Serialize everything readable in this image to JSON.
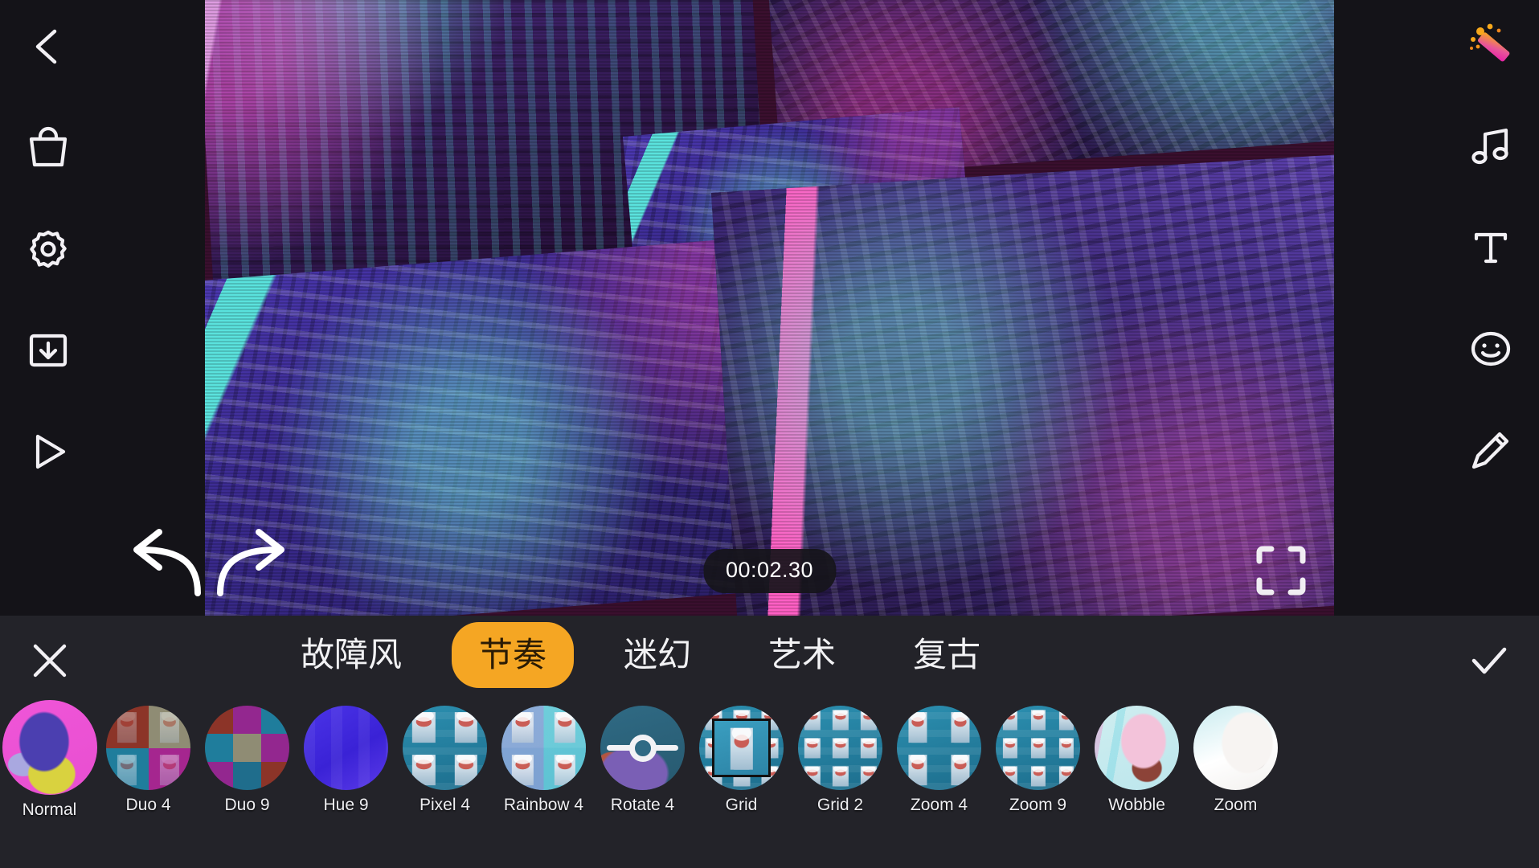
{
  "editor": {
    "timestamp": "00:02.30",
    "left_rail": [
      {
        "name": "back-button",
        "icon": "chevron-left-icon"
      },
      {
        "name": "store-button",
        "icon": "shopping-bag-icon"
      },
      {
        "name": "settings-button",
        "icon": "gear-icon"
      },
      {
        "name": "export-button",
        "icon": "download-icon"
      },
      {
        "name": "play-button",
        "icon": "play-icon"
      }
    ],
    "right_rail": [
      {
        "name": "effects-button",
        "icon": "magic-wand-icon"
      },
      {
        "name": "music-button",
        "icon": "music-note-icon"
      },
      {
        "name": "text-button",
        "icon": "text-t-icon"
      },
      {
        "name": "sticker-button",
        "icon": "smiley-icon"
      },
      {
        "name": "draw-button",
        "icon": "pencil-icon"
      }
    ],
    "undo_icon": "undo-arrow-icon",
    "redo_icon": "redo-arrow-icon",
    "fullscreen_icon": "fullscreen-corners-icon"
  },
  "panel": {
    "close_icon": "close-x-icon",
    "confirm_icon": "checkmark-icon",
    "accent_color": "#f5a623",
    "background_color": "#232329",
    "tabs": [
      {
        "label": "故障风",
        "active": false
      },
      {
        "label": "节奏",
        "active": true
      },
      {
        "label": "迷幻",
        "active": false
      },
      {
        "label": "艺术",
        "active": false
      },
      {
        "label": "复古",
        "active": false
      }
    ],
    "filters": [
      {
        "label": "Normal",
        "style": "normal",
        "selected": true
      },
      {
        "label": "Duo 4",
        "style": "duo4",
        "selected": false
      },
      {
        "label": "Duo 9",
        "style": "duo9",
        "selected": false
      },
      {
        "label": "Hue 9",
        "style": "hue9",
        "selected": false
      },
      {
        "label": "Pixel 4",
        "style": "pixel4",
        "selected": false
      },
      {
        "label": "Rainbow 4",
        "style": "rainbow4",
        "selected": false
      },
      {
        "label": "Rotate 4",
        "style": "rotate4",
        "selected": false
      },
      {
        "label": "Grid",
        "style": "grid",
        "selected": false
      },
      {
        "label": "Grid 2",
        "style": "grid2",
        "selected": false
      },
      {
        "label": "Zoom 4",
        "style": "zoom4",
        "selected": false
      },
      {
        "label": "Zoom 9",
        "style": "zoom9",
        "selected": false
      },
      {
        "label": "Wobble",
        "style": "wobble",
        "selected": false
      },
      {
        "label": "Zoom",
        "style": "zoom",
        "selected": false
      }
    ]
  }
}
